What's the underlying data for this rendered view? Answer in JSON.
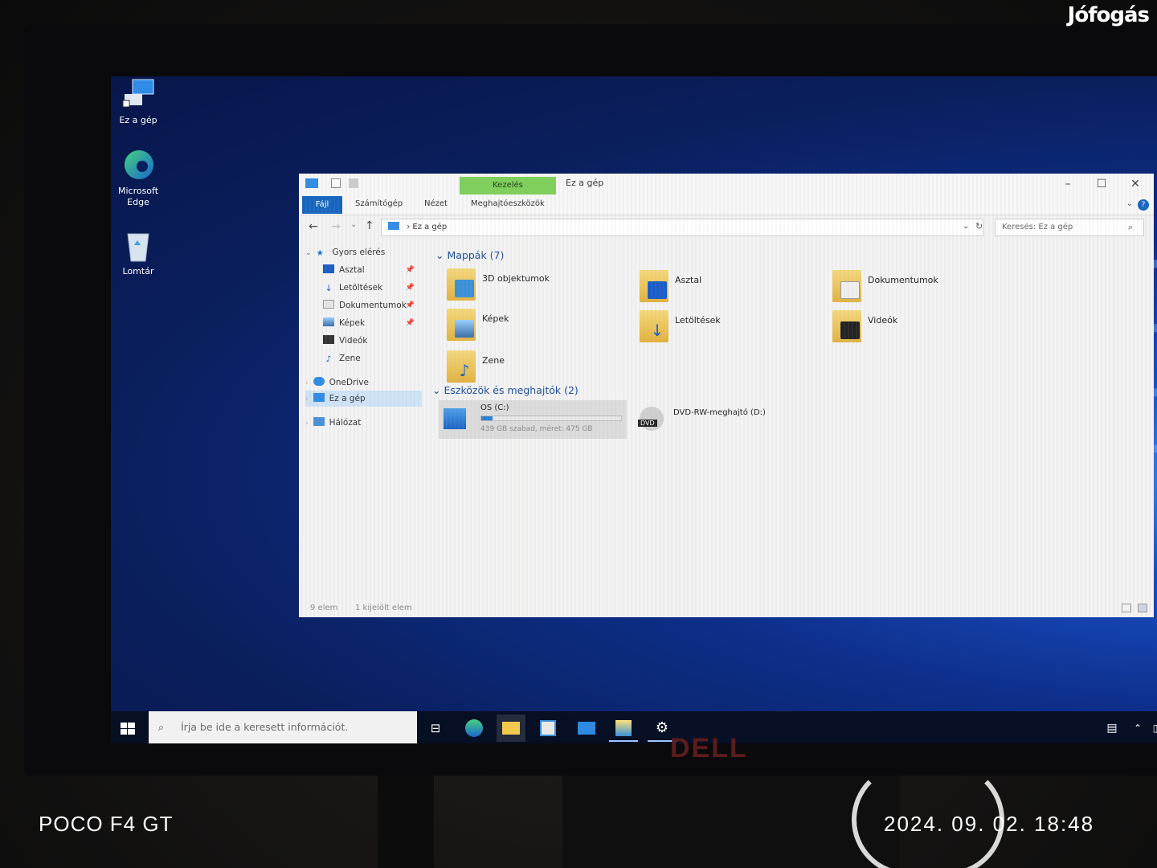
{
  "photo": {
    "watermark": "Jófogás",
    "camera_label": "POCO F4 GT",
    "timestamp": "2024. 09. 02.  18:48",
    "monitor_brand": "DELL"
  },
  "desktop": {
    "icons": [
      {
        "label": "Ez a gép",
        "icon": "computer-icon"
      },
      {
        "label": "Microsoft Edge",
        "icon": "edge-icon"
      },
      {
        "label": "Lomtár",
        "icon": "recycle-bin-icon"
      }
    ]
  },
  "explorer": {
    "window_title": "Ez a gép",
    "context_tab": "Kezelés",
    "ribbon_tabs": [
      "Fájl",
      "Számítógép",
      "Nézet",
      "Meghajtóeszközök"
    ],
    "address": "Ez a gép",
    "search_placeholder": "Keresés: Ez a gép",
    "nav": {
      "quick_access": "Gyors elérés",
      "items": [
        "Asztal",
        "Letöltések",
        "Dokumentumok",
        "Képek",
        "Videók",
        "Zene"
      ],
      "onedrive": "OneDrive",
      "this_pc": "Ez a gép",
      "network": "Hálózat"
    },
    "folders_header": "Mappák (7)",
    "folders": [
      "3D objektumok",
      "Asztal",
      "Dokumentumok",
      "Képek",
      "Letöltések",
      "Videók",
      "Zene"
    ],
    "devices_header": "Eszközök és meghajtók (2)",
    "drive_c": {
      "name": "OS (C:)",
      "detail": "439 GB szabad, méret: 475 GB",
      "used_fraction": 0.08
    },
    "drive_d": {
      "name": "DVD-RW-meghajtó (D:)",
      "badge": "DVD"
    },
    "status_items": "9 elem",
    "status_selected": "1 kijelölt elem"
  },
  "taskbar": {
    "search_placeholder": "Írja be ide a keresett információt."
  },
  "colors": {
    "accent": "#1565c0",
    "context_green": "#7ed05a",
    "desktop_blue": "#0d2f8a"
  }
}
